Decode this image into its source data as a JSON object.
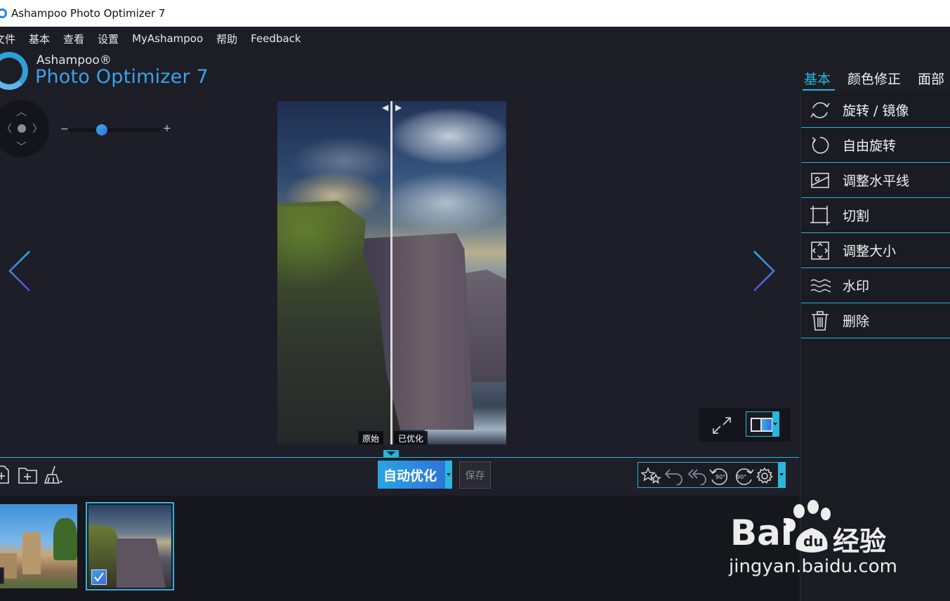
{
  "window": {
    "title": "Ashampoo Photo Optimizer 7"
  },
  "menu": {
    "items": [
      "文件",
      "基本",
      "查看",
      "设置",
      "MyAshampoo",
      "帮助",
      "Feedback"
    ]
  },
  "logo": {
    "brand": "Ashampoo®",
    "product": "Photo Optimizer 7"
  },
  "tabs": {
    "items": [
      "基本",
      "颜色修正",
      "面部"
    ],
    "active_index": 0
  },
  "zoom": {
    "minus": "−",
    "plus": "+",
    "level": 0.42
  },
  "viewer": {
    "label_original": "原始",
    "label_optimized": "已优化",
    "split_position": 0.5
  },
  "panel": {
    "items": [
      {
        "label": "旋转 / 镜像",
        "icon": "rotate-mirror-icon"
      },
      {
        "label": "自由旋转",
        "icon": "free-rotate-icon"
      },
      {
        "label": "调整水平线",
        "icon": "horizon-icon"
      },
      {
        "label": "切割",
        "icon": "crop-icon"
      },
      {
        "label": "调整大小",
        "icon": "resize-icon"
      },
      {
        "label": "水印",
        "icon": "watermark-icon"
      },
      {
        "label": "删除",
        "icon": "trash-icon"
      }
    ]
  },
  "toolbar": {
    "auto_label": "自动优化",
    "save_label": "保存",
    "rotate_left_label": "90°",
    "rotate_right_label": "90°"
  },
  "watermark": {
    "logo_text": "Bai",
    "cn_text": "经验",
    "url": "jingyan.baidu.com"
  },
  "colors": {
    "accent": "#27b5d8",
    "blue": "#2e6fd6",
    "background": "#1d1d26"
  }
}
